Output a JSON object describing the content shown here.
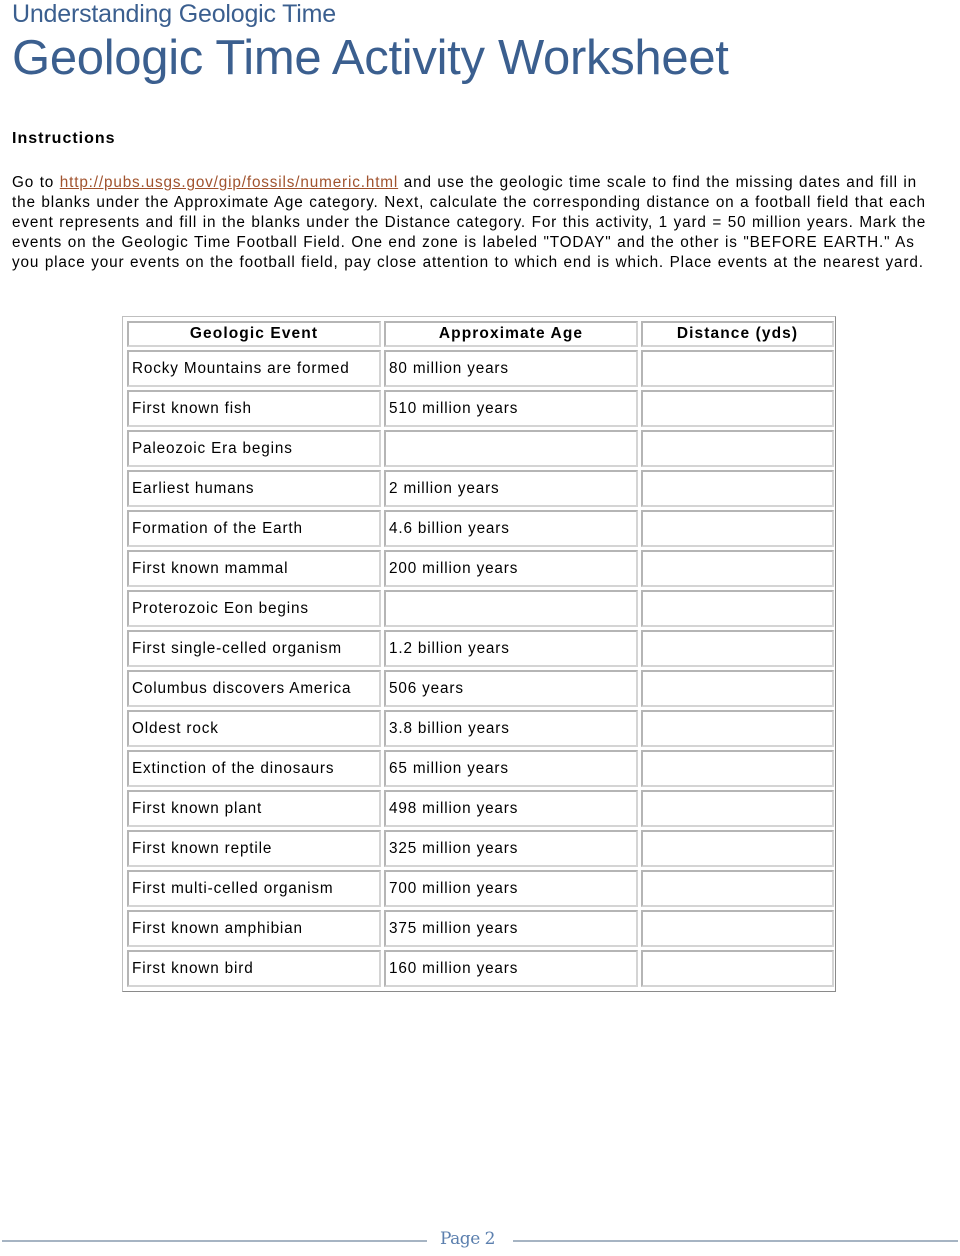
{
  "header": {
    "subtitle": "Understanding Geologic Time",
    "title": "Geologic Time Activity Worksheet"
  },
  "instructions": {
    "heading": "Instructions",
    "text_before_link": "Go to ",
    "link_text": "http://pubs.usgs.gov/gip/fossils/numeric.html",
    "text_after_link": " and use the geologic time scale to find the missing dates and fill in the blanks under the Approximate Age category. Next, calculate the corresponding distance on a football field that each event represents and fill in the blanks under the Distance category. For this activity, 1 yard = 50 million years. Mark the events on the Geologic Time Football Field. One end zone is labeled \"TODAY\" and the other is \"BEFORE EARTH.\" As you place your events on the football field, pay close attention to which end is which. Place events at the nearest yard."
  },
  "table": {
    "headers": [
      "Geologic Event",
      "Approximate Age",
      "Distance (yds)"
    ],
    "rows": [
      {
        "event": "Rocky Mountains are formed",
        "age": "80 million years",
        "distance": ""
      },
      {
        "event": "First known fish",
        "age": "510 million years",
        "distance": ""
      },
      {
        "event": "Paleozoic Era begins",
        "age": "",
        "distance": ""
      },
      {
        "event": "Earliest humans",
        "age": "2 million years",
        "distance": ""
      },
      {
        "event": "Formation of the Earth",
        "age": "4.6 billion years",
        "distance": ""
      },
      {
        "event": "First known mammal",
        "age": "200 million years",
        "distance": ""
      },
      {
        "event": "Proterozoic Eon begins",
        "age": "",
        "distance": ""
      },
      {
        "event": "First single-celled organism",
        "age": "1.2 billion years",
        "distance": ""
      },
      {
        "event": "Columbus discovers America",
        "age": "506 years",
        "distance": ""
      },
      {
        "event": "Oldest rock",
        "age": "3.8 billion years",
        "distance": ""
      },
      {
        "event": "Extinction of the dinosaurs",
        "age": "65 million years",
        "distance": ""
      },
      {
        "event": "First known plant",
        "age": "498 million years",
        "distance": ""
      },
      {
        "event": "First known reptile",
        "age": "325 million years",
        "distance": ""
      },
      {
        "event": "First multi-celled organism",
        "age": "700 million years",
        "distance": ""
      },
      {
        "event": "First known amphibian",
        "age": "375 million years",
        "distance": ""
      },
      {
        "event": "First known bird",
        "age": "160 million years",
        "distance": ""
      }
    ]
  },
  "footer": {
    "page_label": "Page 2"
  },
  "colors": {
    "heading": "#3b5f8f",
    "link": "#a0522d",
    "footer_text": "#5b7fae",
    "footer_rule": "#a6b4c3"
  }
}
